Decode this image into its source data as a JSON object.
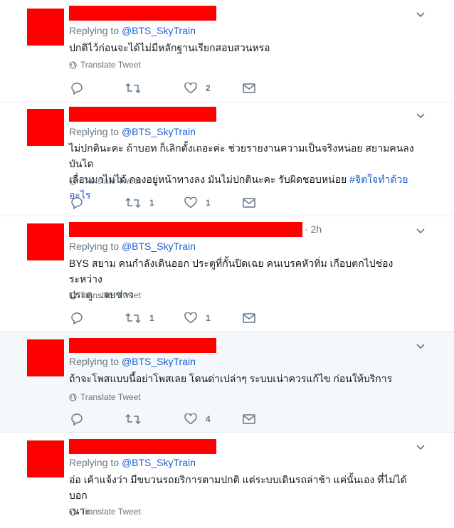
{
  "common": {
    "replying_prefix": "Replying to ",
    "handle": "@BTS_SkyTrain",
    "translate_label": "Translate Tweet"
  },
  "tweets": [
    {
      "text": "ปกติไว้ก่อนจะได้ไม่มีหลักฐานเรียกสอบสวนหรอ",
      "time": "",
      "replies": "",
      "retweets": "",
      "likes": "2"
    },
    {
      "text_line1": "ไม่ปกตินะคะ ถ้าบอท ก็เลิกตั้งเถอะค่ะ ช่วยรายงานความเป็นจริงหน่อย สยามคนลงบันได",
      "text_line2": "เลื่อนมาไม่ได้ กองอยู่หน้าทางลง มันไม่ปกตินะคะ รับผิดชอบหน่อย ",
      "hashtag": "#จิตใจทำด้วยอะไร",
      "time": "",
      "replies": "",
      "retweets": "1",
      "likes": "1"
    },
    {
      "text_line1": "BYS สยาม คนกำลังเดินออก ประตูที่กั้นปิดเฉย คนเบรคหัวทิ่ม เกือบตกไปช่องระหว่าง",
      "text_line2": "ประตู ...จบข่าว",
      "time": "· 2h",
      "replies": "",
      "retweets": "1",
      "likes": "1"
    },
    {
      "text": "ถ้าจะโพสแบบนี้อย่าโพสเลย โดนด่าเปล่าๆ ระบบเน่าควรแก้ไข ก่อนให้บริการ",
      "time": "",
      "replies": "",
      "retweets": "",
      "likes": "4"
    },
    {
      "text_line1": "อ่อ เค้าแจ้งว่า มีขบวนรถยริการตามปกติ  แต่ระบบเดินรถล่าช้า แค่นั้นเอง ที่ไม่ได้บอก",
      "text_line2": "เนาะ",
      "time": ""
    }
  ],
  "colors": {
    "redaction": "#ff0000",
    "link": "#1b5fcf",
    "muted": "#657786",
    "highlight_bg": "#f5f8fa"
  },
  "icons": [
    "avatar-redacted",
    "chevron-down-icon",
    "globe-icon",
    "reply-icon",
    "retweet-icon",
    "heart-icon",
    "message-icon"
  ]
}
